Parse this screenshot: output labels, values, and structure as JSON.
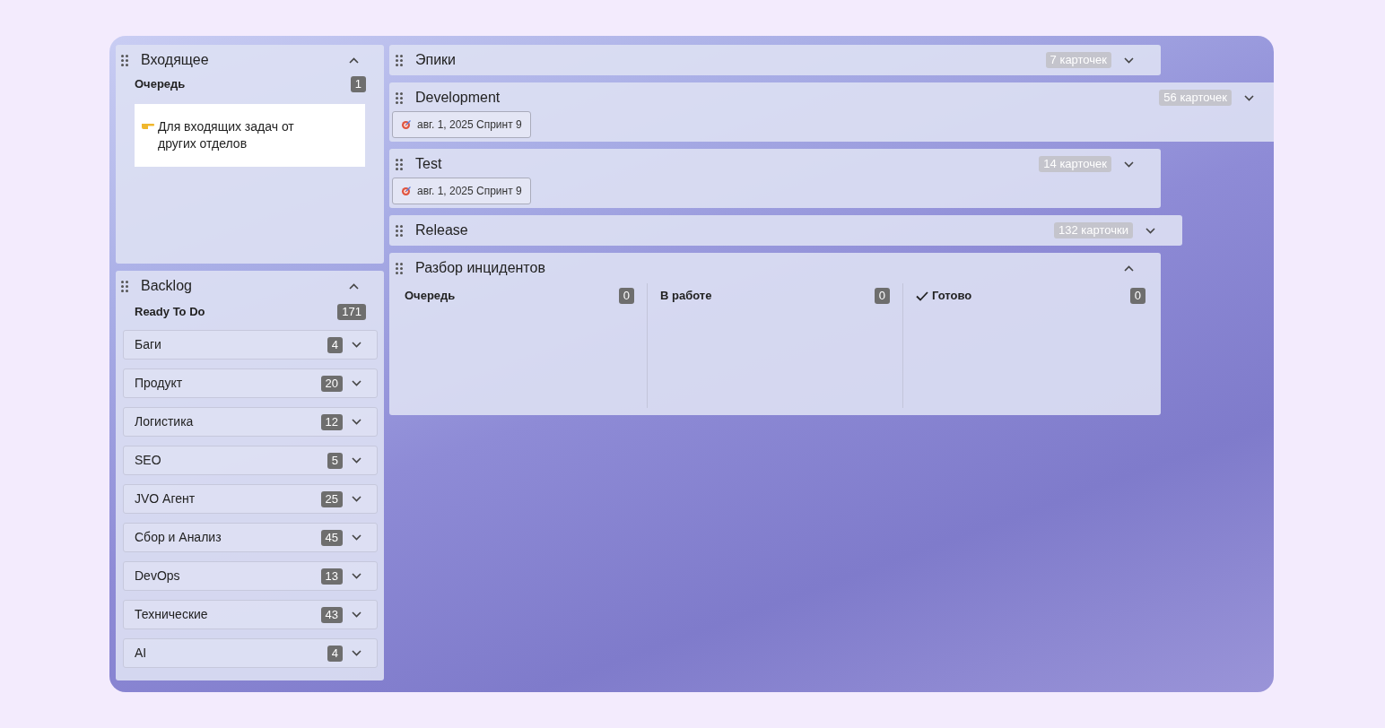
{
  "inbox": {
    "title": "Входящее",
    "expanded": true,
    "column": {
      "title": "Очередь",
      "count": "1"
    },
    "card": {
      "text": "Для входящих задач от других отделов"
    }
  },
  "backlog": {
    "title": "Backlog",
    "expanded": true,
    "column": {
      "title": "Ready To Do",
      "count": "171"
    },
    "swimlanes": [
      {
        "name": "Баги",
        "count": "4",
        "expanded": false
      },
      {
        "name": "Продукт",
        "count": "20",
        "expanded": false
      },
      {
        "name": "Логистика",
        "count": "12",
        "expanded": false
      },
      {
        "name": "SEO",
        "count": "5",
        "expanded": false
      },
      {
        "name": "JVO Агент",
        "count": "25",
        "expanded": false
      },
      {
        "name": "Сбор и Анализ",
        "count": "45",
        "expanded": false
      },
      {
        "name": "DevOps",
        "count": "13",
        "expanded": false
      },
      {
        "name": "Технические",
        "count": "43",
        "expanded": false
      },
      {
        "name": "AI",
        "count": "4",
        "expanded": false
      }
    ]
  },
  "lanes": [
    {
      "title": "Эпики",
      "count": "7 карточек",
      "expanded": false
    },
    {
      "title": "Development",
      "count": "56 карточек",
      "expanded": false,
      "tags": [
        "авг. 1, 2025 Спринт 9"
      ]
    },
    {
      "title": "Test",
      "count": "14 карточек",
      "expanded": false,
      "tags": [
        "авг. 1, 2025 Спринт 9"
      ]
    },
    {
      "title": "Release",
      "count": "132 карточки",
      "expanded": false
    },
    {
      "title": "Разбор инцидентов",
      "expanded": true,
      "columns": [
        {
          "title": "Очередь",
          "count": "0",
          "kind": "plain"
        },
        {
          "title": "В работе",
          "count": "0",
          "kind": "plain"
        },
        {
          "title": "Готово",
          "count": "0",
          "kind": "done"
        }
      ]
    }
  ]
}
